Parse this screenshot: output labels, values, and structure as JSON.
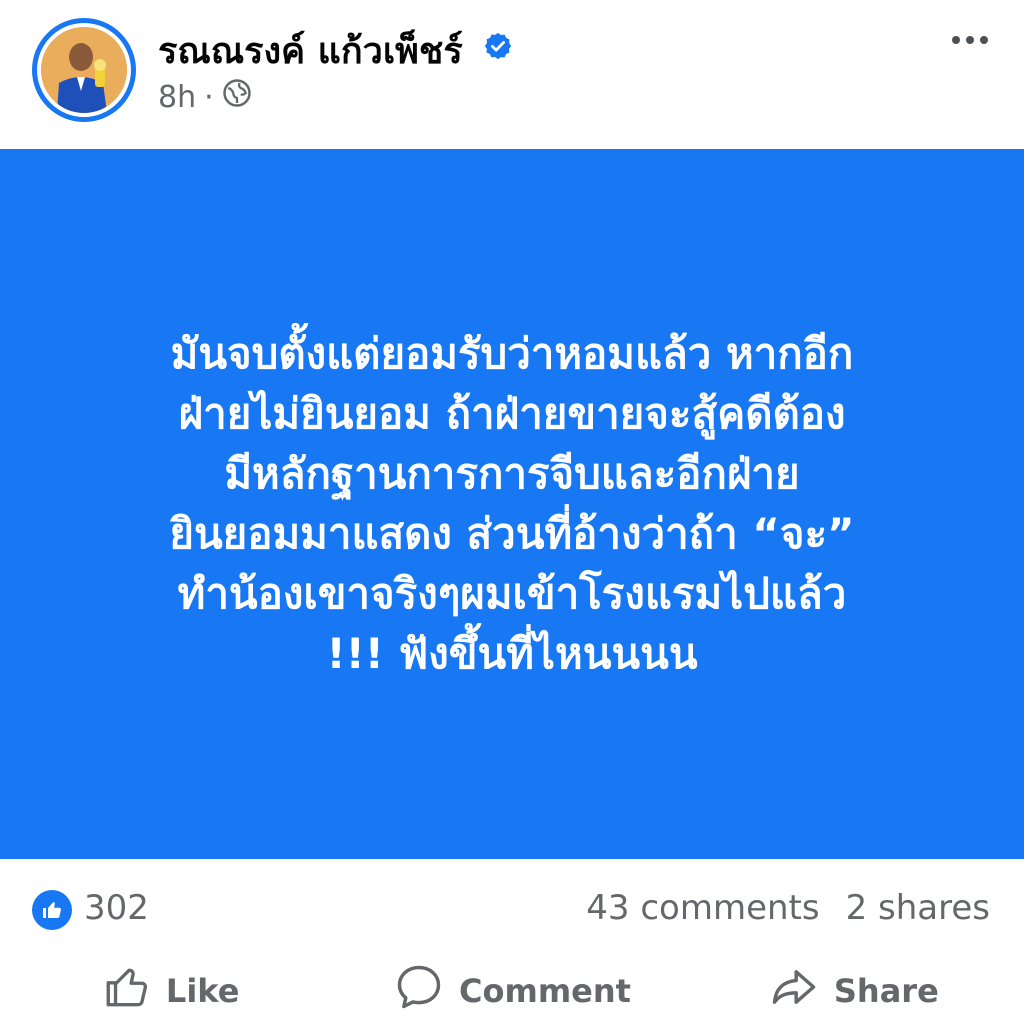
{
  "post": {
    "author": "รณณรงค์ แก้วเพ็ชร์",
    "time": "8h",
    "separator": "·",
    "lines": [
      "มันจบตั้งแต่ยอมรับว่าหอมแล้ว หากอีก",
      "ฝ่ายไม่ยินยอม ถ้าฝ่ายขายจะสู้คดีต้อง",
      "มีหลักฐานการการจีบและอีกฝ่าย",
      "ยินยอมมาแสดง ส่วนที่อ้างว่าถ้า “จะ”",
      "ทำน้องเขาจริงๆผมเข้าโรงแรมไปแล้ว",
      "!!! ฟังขึ้นที่ไหนนนน"
    ],
    "background_color": "#1877f2"
  },
  "stats": {
    "likes": "302",
    "comments": "43 comments",
    "shares": "2 shares"
  },
  "actions": {
    "like": "Like",
    "comment": "Comment",
    "share": "Share"
  },
  "icons": {
    "verified": "verified-badge-icon",
    "audience": "globe-icon",
    "more": "more-options-icon",
    "like_reaction": "thumbs-up-icon",
    "like_action": "thumbs-up-outline-icon",
    "comment_action": "speech-bubble-icon",
    "share_action": "share-arrow-icon"
  }
}
